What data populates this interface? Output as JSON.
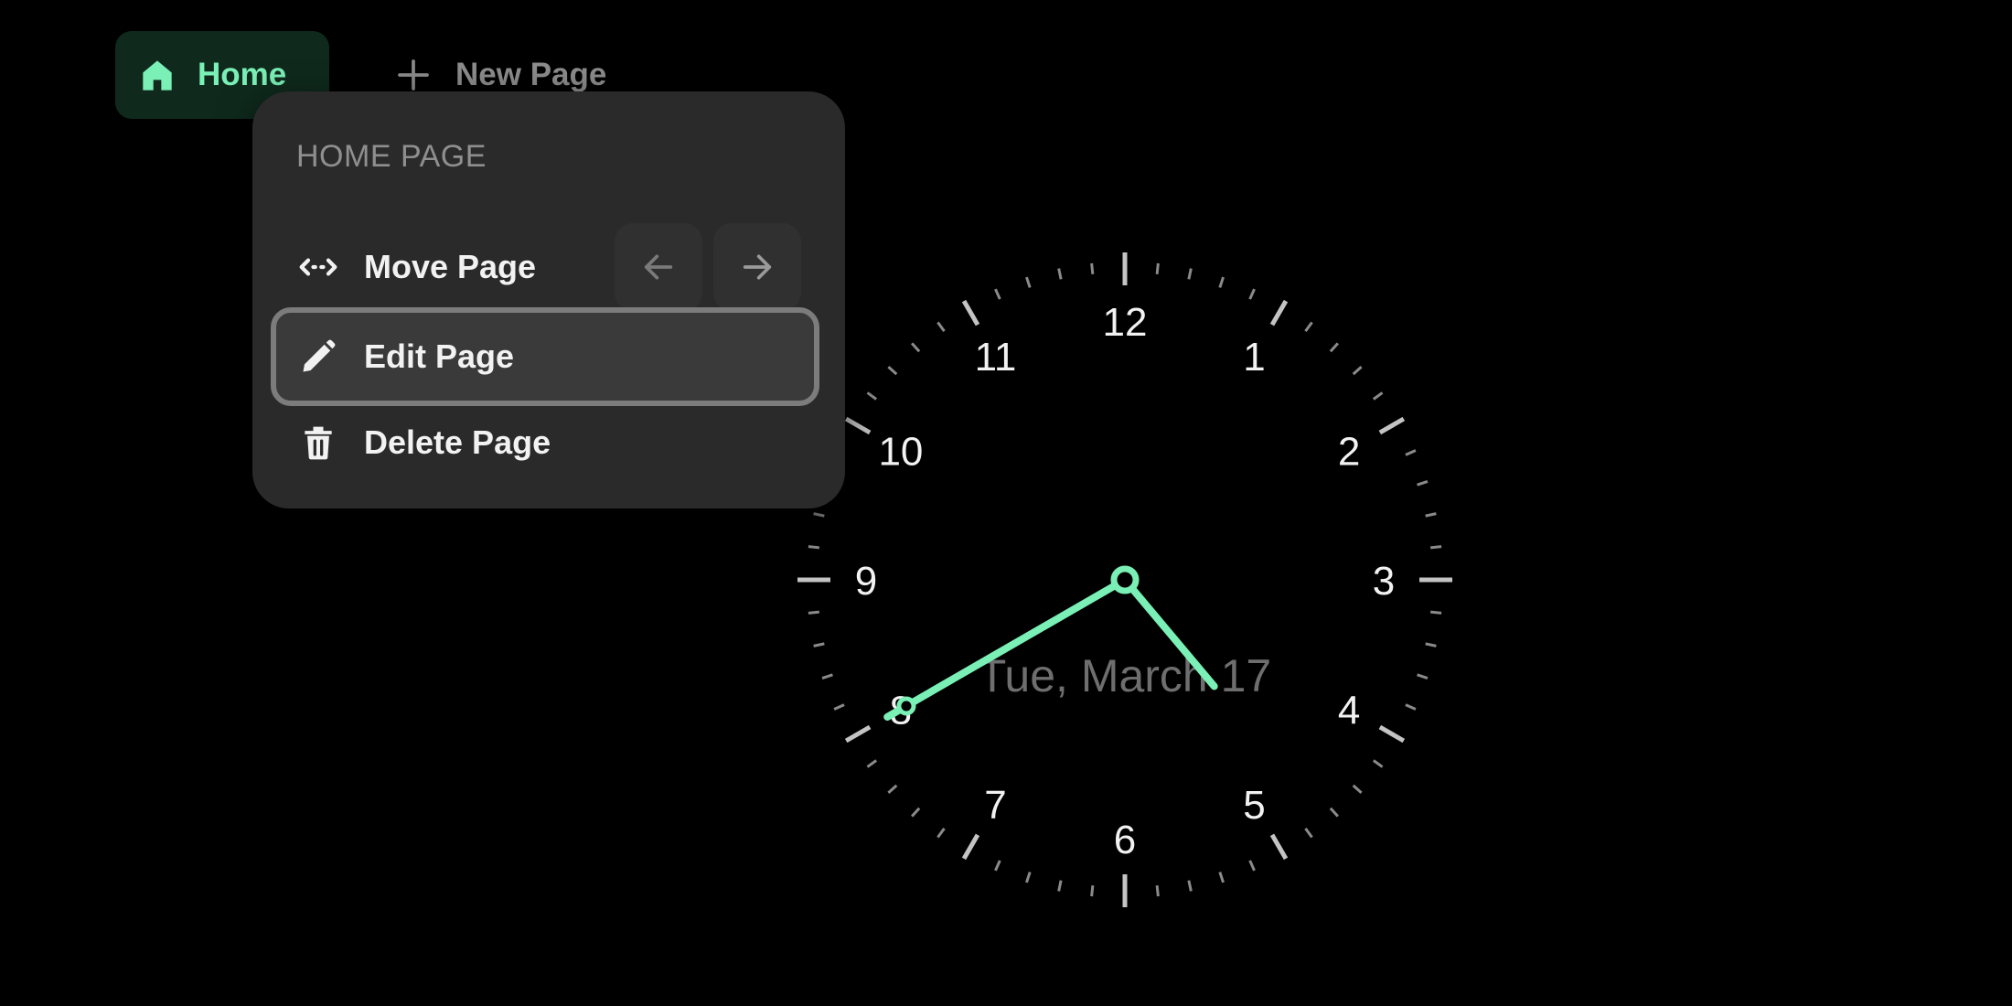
{
  "tabs": {
    "home": {
      "label": "Home",
      "icon": "home-icon"
    },
    "new_page": {
      "label": "New Page",
      "icon": "plus-icon"
    }
  },
  "context_menu": {
    "title": "HOME PAGE",
    "items": [
      {
        "label": "Move Page",
        "icon": "move-horizontal-icon"
      },
      {
        "label": "Edit Page",
        "icon": "pencil-icon",
        "highlighted": true
      },
      {
        "label": "Delete Page",
        "icon": "trash-icon"
      }
    ],
    "move_left_icon": "arrow-left-icon",
    "move_right_icon": "arrow-right-icon"
  },
  "clock": {
    "numerals": [
      "12",
      "1",
      "2",
      "3",
      "4",
      "5",
      "6",
      "7",
      "8",
      "9",
      "10",
      "11"
    ],
    "date_text": "Tue, March 17",
    "hour": 4,
    "minute": 40,
    "second": 0
  },
  "colors": {
    "accent": "#7af0b6",
    "background": "#000000",
    "menu_background": "#2a2a2a",
    "tab_active_background": "#0f2a1d",
    "muted_text": "#8d8d8d"
  }
}
